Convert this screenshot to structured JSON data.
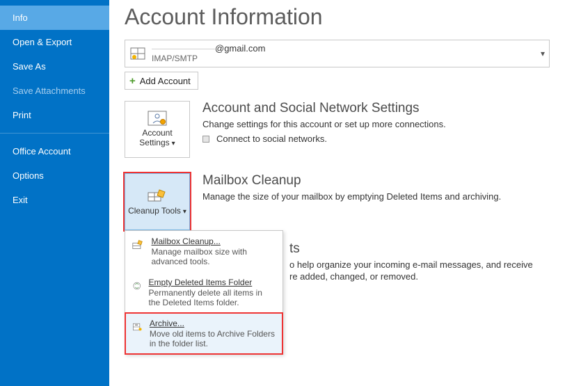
{
  "sidebar": {
    "items": [
      {
        "label": "Info",
        "state": "selected"
      },
      {
        "label": "Open & Export",
        "state": ""
      },
      {
        "label": "Save As",
        "state": ""
      },
      {
        "label": "Save Attachments",
        "state": "disabled"
      },
      {
        "label": "Print",
        "state": ""
      }
    ],
    "lower": [
      {
        "label": "Office Account"
      },
      {
        "label": "Options"
      },
      {
        "label": "Exit"
      }
    ]
  },
  "page": {
    "title": "Account Information",
    "account": {
      "email_suffix": "@gmail.com",
      "proto": "IMAP/SMTP"
    },
    "add_account": "Add Account",
    "settings": {
      "tile": "Account Settings",
      "title": "Account and Social Network Settings",
      "desc": "Change settings for this account or set up more connections.",
      "bullet": "Connect to social networks."
    },
    "cleanup": {
      "tile": "Cleanup Tools",
      "title": "Mailbox Cleanup",
      "desc": "Manage the size of your mailbox by emptying Deleted Items and archiving.",
      "menu": {
        "mailbox": {
          "name": "Mailbox Cleanup...",
          "desc": "Manage mailbox size with advanced tools."
        },
        "empty": {
          "name": "Empty Deleted Items Folder",
          "desc": "Permanently delete all items in the Deleted Items folder."
        },
        "archive": {
          "name": "Archive...",
          "desc": "Move old items to Archive Folders in the folder list."
        }
      }
    },
    "rules": {
      "title_fragment": "ts",
      "desc_line1": "o help organize your incoming e-mail messages, and receive",
      "desc_line2": "re added, changed, or removed."
    }
  }
}
